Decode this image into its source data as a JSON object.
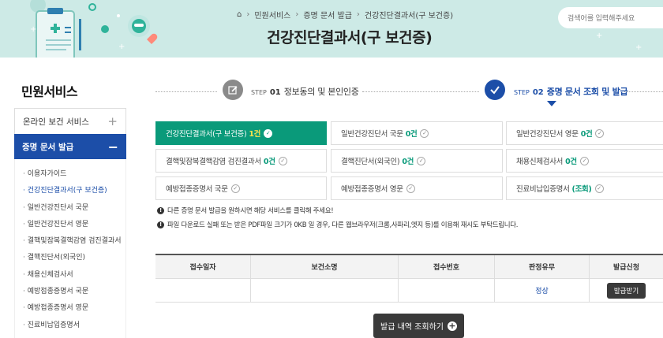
{
  "header": {
    "breadcrumb": [
      "민원서비스",
      "증명 문서 발급",
      "건강진단결과서(구 보건증)"
    ],
    "title": "건강진단결과서(구 보건증)",
    "search_placeholder": "검색어를 입력해주세요"
  },
  "sidebar": {
    "title": "민원서비스",
    "menu_item": "온라인 보건 서비스",
    "active_item": "증명 문서 발급",
    "sub_items": [
      "이용자가이드",
      "건강진단결과서(구 보건증)",
      "일반건강진단서 국문",
      "일반건강진단서 영문",
      "결핵및잠복결핵감염 검진결과서",
      "결핵진단서(외국인)",
      "채용신체검사서",
      "예방접종증명서 국문",
      "예방접종증명서 영문",
      "진료비납입증명서"
    ],
    "active_sub_index": 1
  },
  "steps": [
    {
      "prefix": "STEP",
      "num": "01",
      "label": "정보동의 및 본인인증"
    },
    {
      "prefix": "STEP",
      "num": "02",
      "label": "증명 문서 조회 및 발급"
    }
  ],
  "documents": [
    {
      "name": "건강진단결과서(구 보건증)",
      "count": "1건",
      "active": true
    },
    {
      "name": "일반건강진단서 국문",
      "count": "0건"
    },
    {
      "name": "일반건강진단서 영문",
      "count": "0건"
    },
    {
      "name": "결핵및잠복결핵감염 검진결과서",
      "count": "0건"
    },
    {
      "name": "결핵진단서(외국인)",
      "count": "0건"
    },
    {
      "name": "채용신체검사서",
      "count": "0건"
    },
    {
      "name": "예방접종증명서 국문",
      "count": ""
    },
    {
      "name": "예방접종증명서 영문",
      "count": ""
    },
    {
      "name": "진료비납입증명서",
      "count": "(조회)"
    }
  ],
  "notices": [
    "다른 증명 문서 발급을 원하시면 해당 서비스를 클릭해 주세요!",
    "파일 다운로드 실패 또는 받은 PDF파일 크기가 0KB 일 경우, 다른 웹브라우저(크롬,사파리,엣지 등)를 이용해 재시도 부탁드립니다."
  ],
  "table": {
    "headers": [
      "접수일자",
      "보건소명",
      "접수번호",
      "판정유무",
      "발급신청"
    ],
    "rows": [
      {
        "date": "",
        "center": "",
        "number": "",
        "result": "정상",
        "action": "발급받기"
      }
    ]
  },
  "view_history_button": "발급 내역 조회하기",
  "colors": {
    "primary": "#1c4ea8",
    "green": "#0a9a7a",
    "header_bg": "#cdeae6"
  }
}
